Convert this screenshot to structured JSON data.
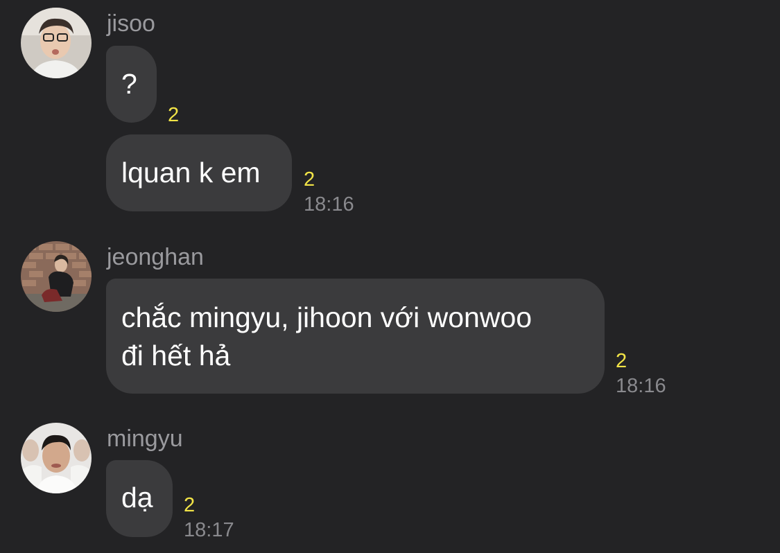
{
  "theme": {
    "background": "#232325",
    "bubble_color": "#3b3b3d",
    "unread_color": "#f2e447",
    "meta_color": "#8a8a8e"
  },
  "messages": [
    {
      "sender": "jisoo",
      "avatar_icon": "profile-photo-icon",
      "bubbles": [
        {
          "text": "?",
          "unread": "2",
          "time": ""
        },
        {
          "text": "lquan k em",
          "unread": "2",
          "time": "18:16"
        }
      ]
    },
    {
      "sender": "jeonghan",
      "avatar_icon": "profile-photo-icon",
      "bubbles": [
        {
          "text": "chắc mingyu, jihoon với wonwoo\nđi hết hả",
          "unread": "2",
          "time": "18:16"
        }
      ]
    },
    {
      "sender": "mingyu",
      "avatar_icon": "profile-photo-icon",
      "bubbles": [
        {
          "text": "dạ",
          "unread": "2",
          "time": "18:17"
        }
      ]
    }
  ]
}
